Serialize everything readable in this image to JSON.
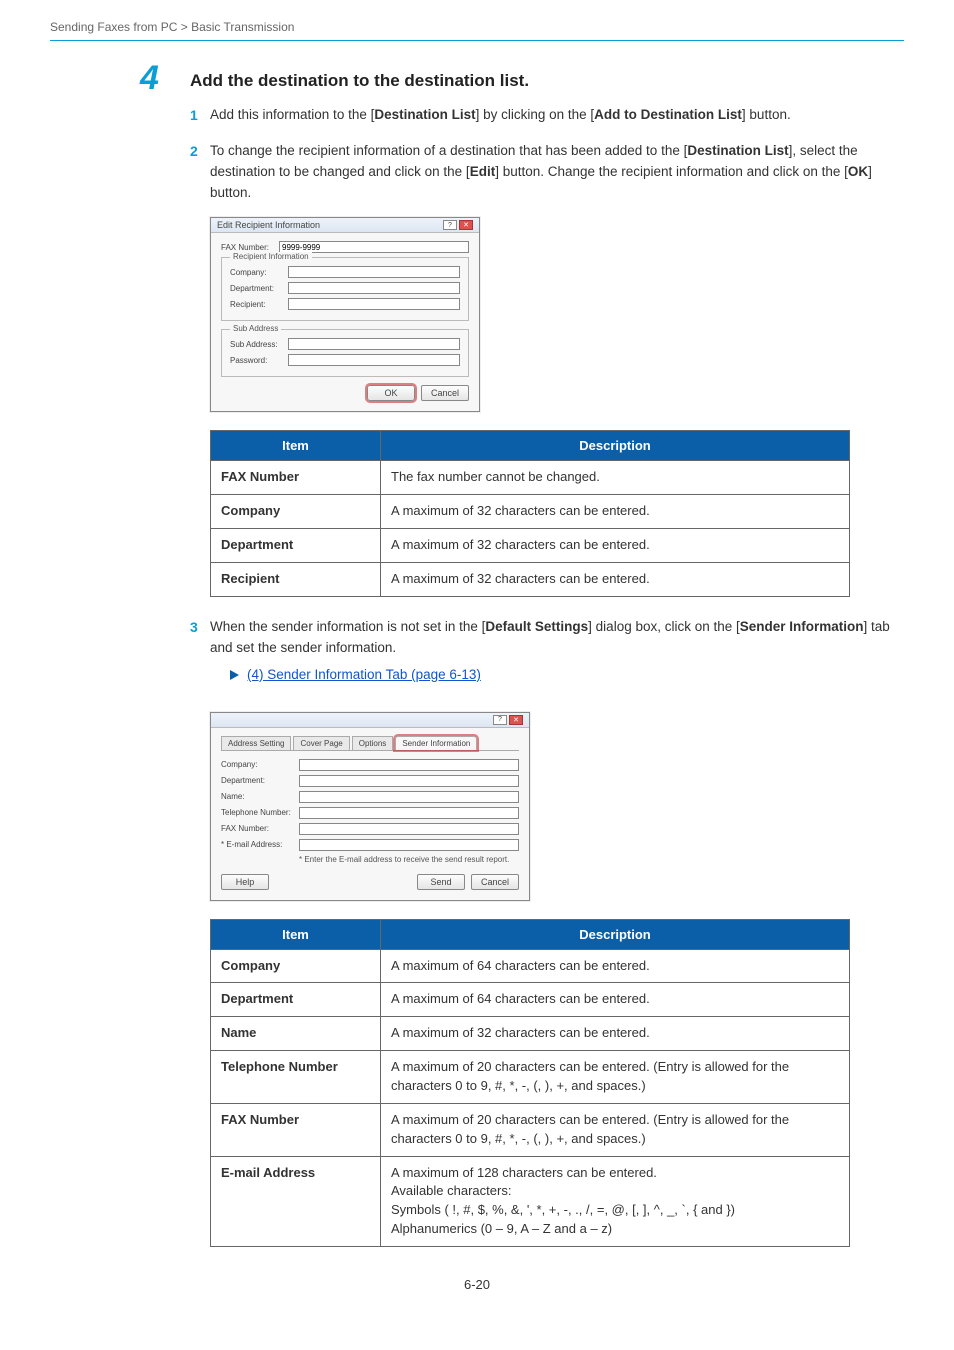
{
  "breadcrumb": "Sending Faxes from PC > Basic Transmission",
  "step_number": "4",
  "step_title": "Add the destination to the destination list.",
  "substeps": {
    "s1": {
      "num": "1",
      "pre": "Add this information to the [",
      "bold1": "Destination List",
      "mid": "] by clicking on the [",
      "bold2": "Add to Destination List",
      "post": "] button."
    },
    "s2": {
      "num": "2",
      "pre": "To change the recipient information of a destination that has been added to the [",
      "bold1": "Destination List",
      "mid1": "], select the destination to be changed and click on the [",
      "bold2": "Edit",
      "mid2": "] button. Change the recipient information and click on the [",
      "bold3": "OK",
      "post": "] button."
    },
    "s3": {
      "num": "3",
      "pre": "When the sender information is not set in the [",
      "bold1": "Default Settings",
      "mid": "] dialog box, click on the [",
      "bold2": "Sender Information",
      "post": "] tab and set the sender information."
    }
  },
  "xref": "(4) Sender Information Tab (page 6-13)",
  "dialog1": {
    "title": "Edit Recipient Information",
    "fax_label": "FAX Number:",
    "fax_value": "9999-9999",
    "group_recipient": "Recipient Information",
    "company": "Company:",
    "department": "Department:",
    "recipient": "Recipient:",
    "group_sub": "Sub Address",
    "subaddress": "Sub Address:",
    "password": "Password:",
    "ok": "OK",
    "cancel": "Cancel"
  },
  "dialog2": {
    "title": " ",
    "tab1": "Address Setting",
    "tab2": "Cover Page",
    "tab3": "Options",
    "tab4": "Sender Information",
    "company": "Company:",
    "department": "Department:",
    "name": "Name:",
    "telephone": "Telephone Number:",
    "fax": "FAX Number:",
    "email": "* E-mail Address:",
    "note": "* Enter the E-mail address to receive the send result report.",
    "help": "Help",
    "send": "Send",
    "cancel": "Cancel"
  },
  "table1": {
    "h1": "Item",
    "h2": "Description",
    "rows": [
      {
        "item": "FAX Number",
        "desc": "The fax number cannot be changed."
      },
      {
        "item": "Company",
        "desc": "A maximum of 32 characters can be entered."
      },
      {
        "item": "Department",
        "desc": "A maximum of 32 characters can be entered."
      },
      {
        "item": "Recipient",
        "desc": "A maximum of 32 characters can be entered."
      }
    ]
  },
  "table2": {
    "h1": "Item",
    "h2": "Description",
    "rows": [
      {
        "item": "Company",
        "desc": "A maximum of 64 characters can be entered."
      },
      {
        "item": "Department",
        "desc": "A maximum of 64 characters can be entered."
      },
      {
        "item": "Name",
        "desc": "A maximum of 32 characters can be entered."
      },
      {
        "item": "Telephone Number",
        "desc": "A maximum of 20 characters can be entered. (Entry is allowed for the characters 0 to 9, #, *, -, (, ), +, and spaces.)"
      },
      {
        "item": "FAX Number",
        "desc": "A maximum of 20 characters can be entered. (Entry is allowed for the characters 0 to 9, #, *, -, (, ), +, and spaces.)"
      },
      {
        "item": "E-mail Address",
        "desc": "A maximum of 128 characters can be entered.\nAvailable characters:\nSymbols ( !, #, $, %, &, ', *, +, -, ., /, =, @, [, ], ^, _, `, { and })\nAlphanumerics (0 – 9, A – Z and a – z)"
      }
    ]
  },
  "page_number": "6-20"
}
